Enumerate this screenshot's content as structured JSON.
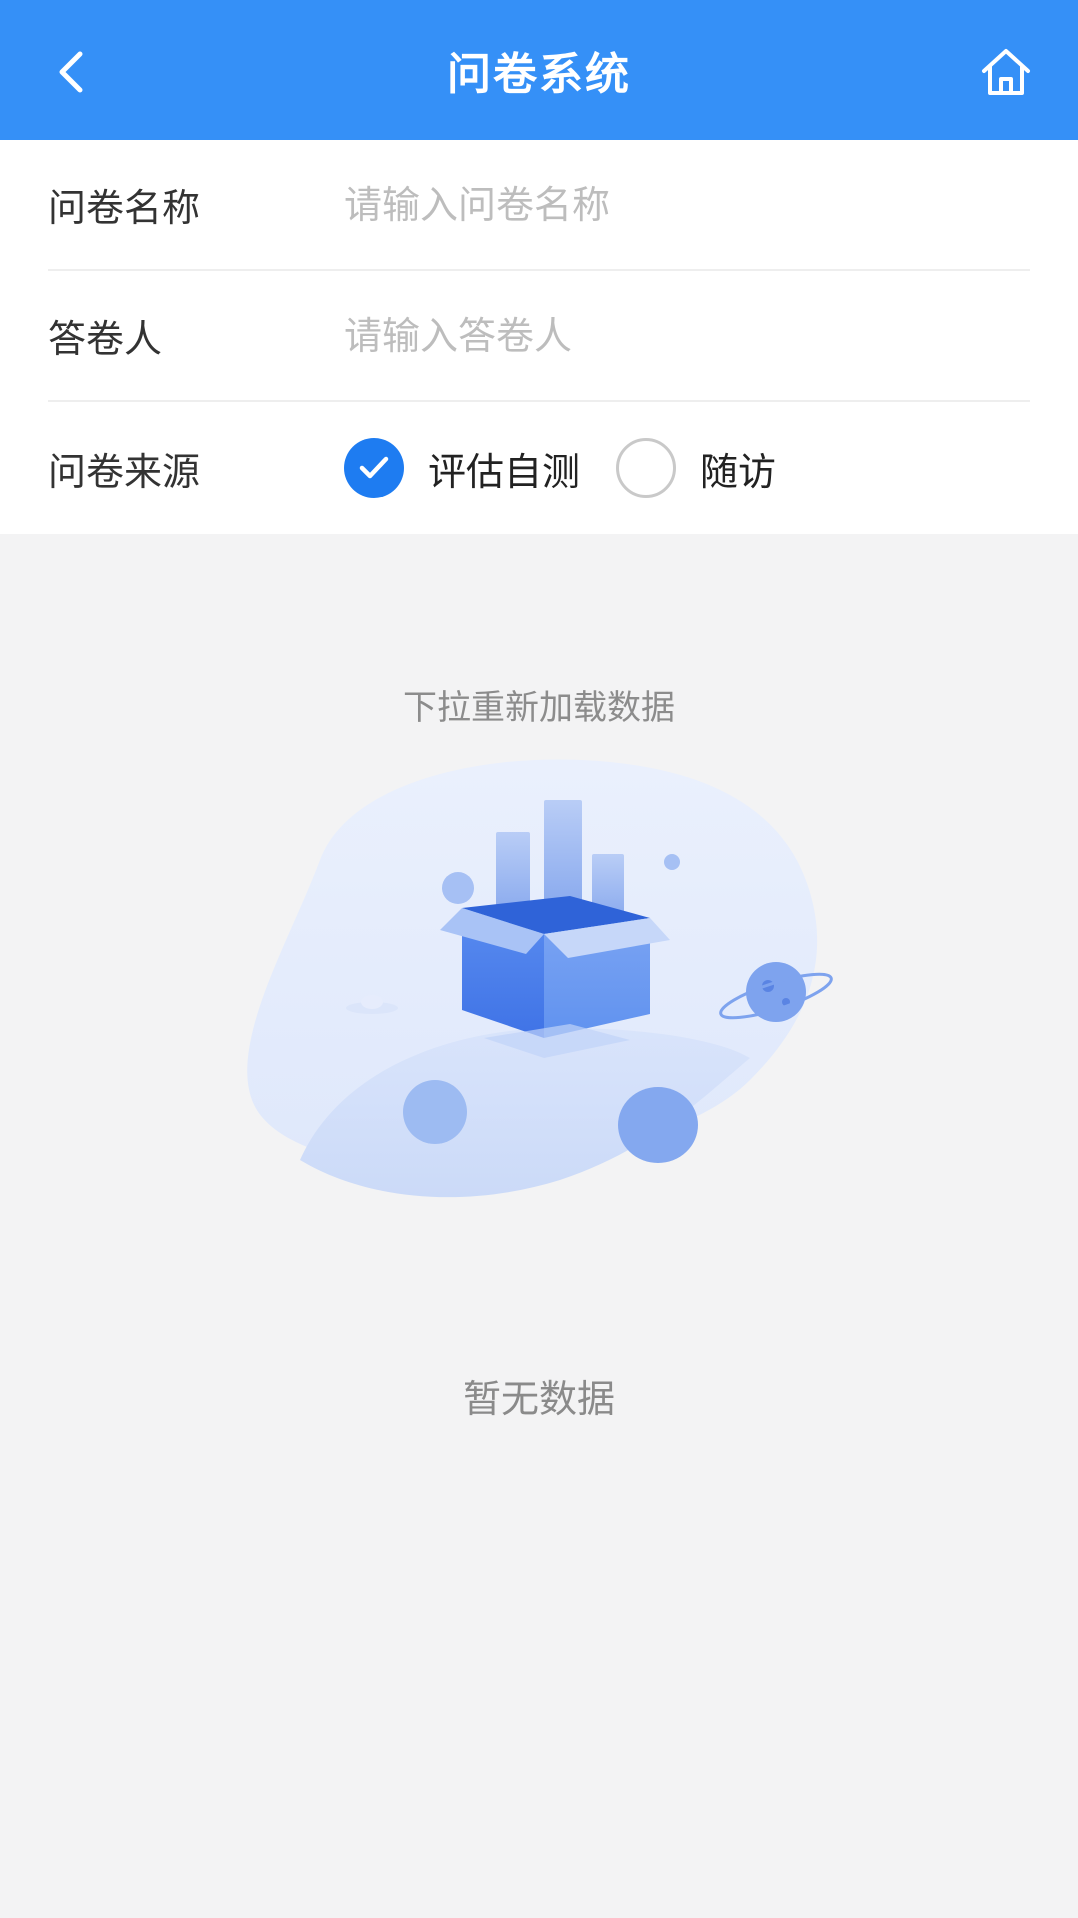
{
  "header": {
    "title": "问卷系统",
    "back_icon": "chevron-left-icon",
    "home_icon": "home-icon",
    "bg_color": "#3590f7"
  },
  "form": {
    "name_field": {
      "label": "问卷名称",
      "placeholder": "请输入问卷名称",
      "value": ""
    },
    "respondent_field": {
      "label": "答卷人",
      "placeholder": "请输入答卷人",
      "value": ""
    },
    "source_field": {
      "label": "问卷来源",
      "options": [
        {
          "label": "评估自测",
          "selected": true
        },
        {
          "label": "随访",
          "selected": false
        }
      ]
    }
  },
  "empty_state": {
    "pull_hint": "下拉重新加载数据",
    "illustration_icon": "empty-box-illustration",
    "message": "暂无数据"
  },
  "colors": {
    "accent": "#1e7cf1",
    "background": "#f3f3f4"
  }
}
